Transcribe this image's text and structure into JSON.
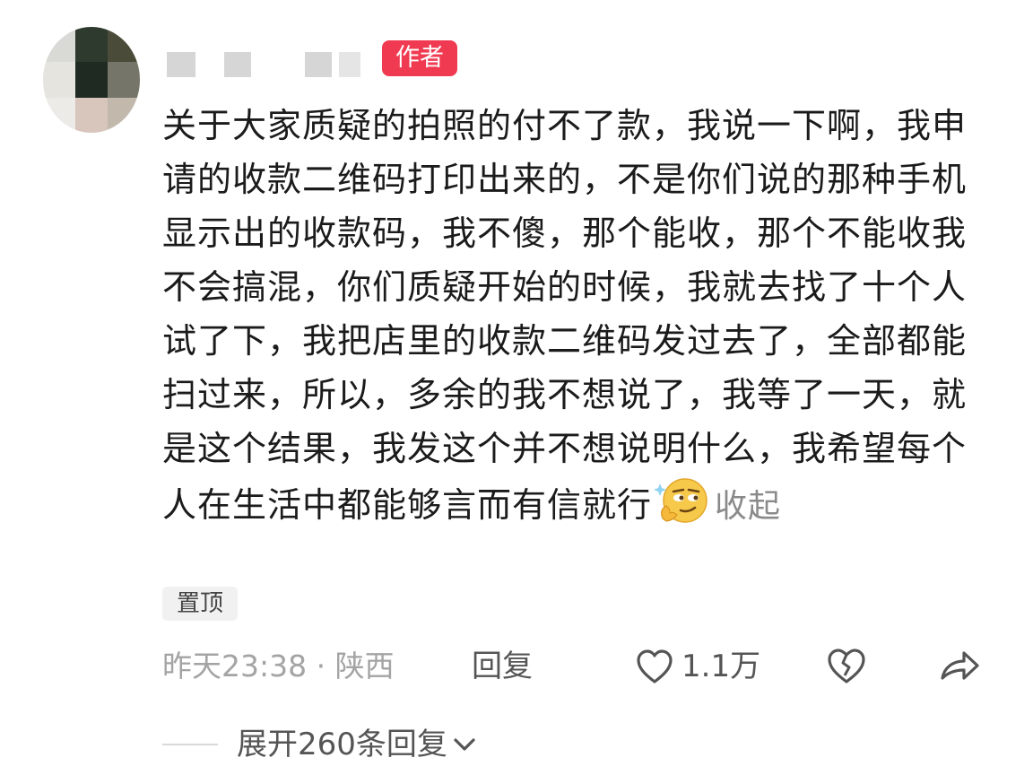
{
  "comment": {
    "author_badge": "作者",
    "text": "关于大家质疑的拍照的付不了款，我说一下啊，我申请的收款二维码打印出来的，不是你们说的那种手机显示出的收款码，我不傻，那个能收，那个不能收我不会搞混，你们质疑开始的时候，我就去找了十个人试了下，我把店里的收款二维码发过去了，全部都能扫过来，所以，多余的我不想说了，我等了一天，就是这个结果，我发这个并不想说明什么，我希望每个人在生活中都能够言而有信就行",
    "collapse_label": "收起",
    "pin_tag": "置顶",
    "timestamp_location": "昨天23:38 · 陕西",
    "reply_label": "回复",
    "like_count": "1.1万",
    "expand_replies": "展开260条回复"
  },
  "icons": {
    "emoji": "smirk-emoji",
    "like": "heart-outline-icon",
    "dislike": "broken-heart-icon",
    "share": "share-arrow-icon",
    "expand": "chevron-down-icon"
  },
  "colors": {
    "badge": "#f03a52",
    "text": "#1b1b1b",
    "muted": "#a4a4a4"
  }
}
